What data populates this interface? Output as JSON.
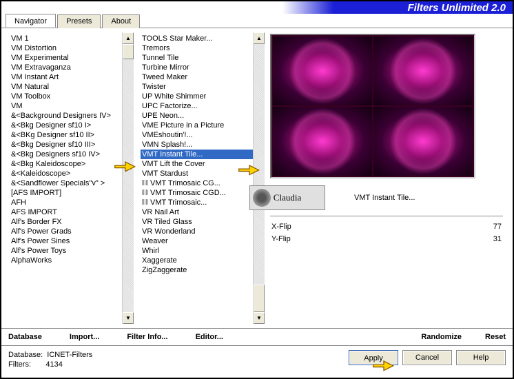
{
  "title": "Filters Unlimited 2.0",
  "tabs": [
    "Navigator",
    "Presets",
    "About"
  ],
  "activeTab": 0,
  "leftList": [
    "VM 1",
    "VM Distortion",
    "VM Experimental",
    "VM Extravaganza",
    "VM Instant Art",
    "VM Natural",
    "VM Toolbox",
    "VM",
    "&<Background Designers IV>",
    "&<Bkg Designer sf10 I>",
    "&<BKg Designer sf10 II>",
    "&<Bkg Designer sf10 III>",
    "&<Bkg Designers sf10 IV>",
    "&<Bkg Kaleidoscope>",
    "&<Kaleidoscope>",
    "&<Sandflower Specials\"v\" >",
    "[AFS IMPORT]",
    "AFH",
    "AFS IMPORT",
    "Alf's Border FX",
    "Alf's Power Grads",
    "Alf's Power Sines",
    "Alf's Power Toys",
    "AlphaWorks"
  ],
  "rightList": [
    "TOOLS Star Maker...",
    "Tremors",
    "Tunnel Tile",
    "Turbine Mirror",
    "Tweed Maker",
    "Twister",
    "UP White Shimmer",
    "UPC Factorize...",
    "UPE Neon...",
    "VME Picture in a Picture",
    "VMEshoutin'!...",
    "VMN Splash!...",
    "VMT Instant Tile...",
    "VMT Lift the Cover",
    "VMT Stardust",
    "VMT Trimosaic CG...",
    "VMT Trimosaic CGD...",
    "VMT Trimosaic...",
    "VR Nail Art",
    "VR Tiled Glass",
    "VR Wonderland",
    "Weaver",
    "Whirl",
    "Xaggerate",
    "ZigZaggerate"
  ],
  "selectedRight": 12,
  "badge": "Claudia",
  "filterName": "VMT Instant Tile...",
  "params": [
    {
      "name": "X-Flip",
      "value": "77"
    },
    {
      "name": "Y-Flip",
      "value": "31"
    }
  ],
  "toolbarLeft": [
    "Database",
    "Import...",
    "Filter Info...",
    "Editor..."
  ],
  "toolbarRight": [
    "Randomize",
    "Reset"
  ],
  "status": {
    "dbLabel": "Database:",
    "dbVal": "ICNET-Filters",
    "flLabel": "Filters:",
    "flVal": "4134"
  },
  "buttons": {
    "apply": "Apply",
    "cancel": "Cancel",
    "help": "Help"
  }
}
